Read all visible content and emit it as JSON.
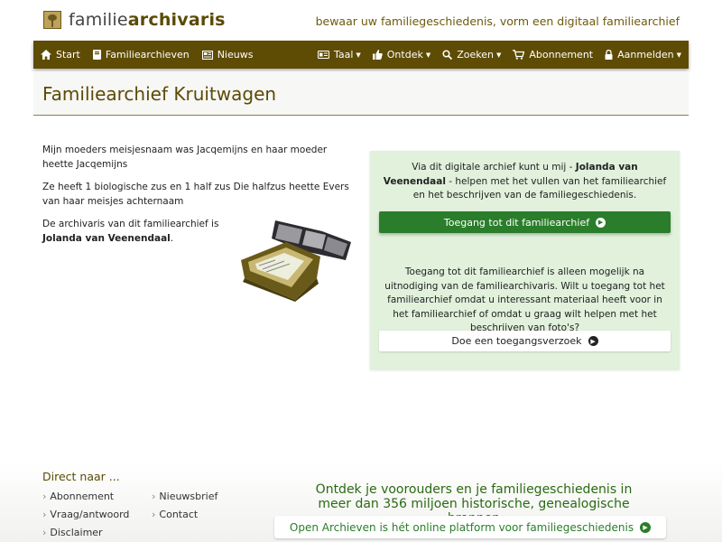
{
  "header": {
    "logo_prefix": "familie",
    "logo_bold": "archivaris",
    "tagline": "bewaar uw familiegeschiedenis, vorm een digitaal familiearchief"
  },
  "nav": {
    "left": [
      {
        "label": "Start",
        "icon": "home-icon"
      },
      {
        "label": "Familiearchieven",
        "icon": "book-icon"
      },
      {
        "label": "Nieuws",
        "icon": "newspaper-icon"
      }
    ],
    "right": [
      {
        "label": "Taal",
        "icon": "language-icon",
        "dropdown": true
      },
      {
        "label": "Ontdek",
        "icon": "thumbs-up-icon",
        "dropdown": true
      },
      {
        "label": "Zoeken",
        "icon": "search-icon",
        "dropdown": true
      },
      {
        "label": "Abonnement",
        "icon": "cart-icon",
        "dropdown": false
      },
      {
        "label": "Aanmelden",
        "icon": "lock-icon",
        "dropdown": true
      }
    ]
  },
  "page": {
    "title": "Familiearchief Kruitwagen",
    "para1": "Mijn moeders meisjesnaam was Jacqemijns en haar moeder heette Jacqemijns",
    "para2": "Ze heeft 1 biologische zus en 1 half zus Die halfzus heette Evers van haar meisjes achternaam",
    "para3_prefix": "De archivaris van dit familiearchief is",
    "archivist": "Jolanda van Veenendaal",
    "para3_suffix": "."
  },
  "panel": {
    "text1_prefix": "Via dit digitale archief kunt u mij - ",
    "text1_name": "Jolanda van Veenendaal",
    "text1_suffix": " - helpen met het vullen van het familiearchief en het beschrijven van de familiegeschiedenis.",
    "access_button": "Toegang tot dit familiearchief",
    "text2": "Toegang tot dit familiearchief is alleen mogelijk na uitnodiging van de familiearchivaris. Wilt u toegang tot het familiearchief omdat u interessant materiaal heeft voor in het familiearchief of omdat u graag wilt helpen met het beschrijven van foto's?",
    "request_button": "Doe een toegangsverzoek"
  },
  "footer": {
    "direct_title": "Direct naar ...",
    "links_col1": [
      "Abonnement",
      "Vraag/antwoord",
      "Disclaimer"
    ],
    "links_col2": [
      "Nieuwsbrief",
      "Contact"
    ],
    "cta": "Ontdek je voorouders en je familiegeschiedenis in meer dan 356 miljoen historische, genealogische bronnen",
    "oa_button": "Open Archieven is hét online platform voor familiegeschiedenis"
  },
  "colors": {
    "brand": "#5e4c05",
    "accent_green": "#2a7d2a",
    "panel_bg": "#e1f1dc"
  }
}
